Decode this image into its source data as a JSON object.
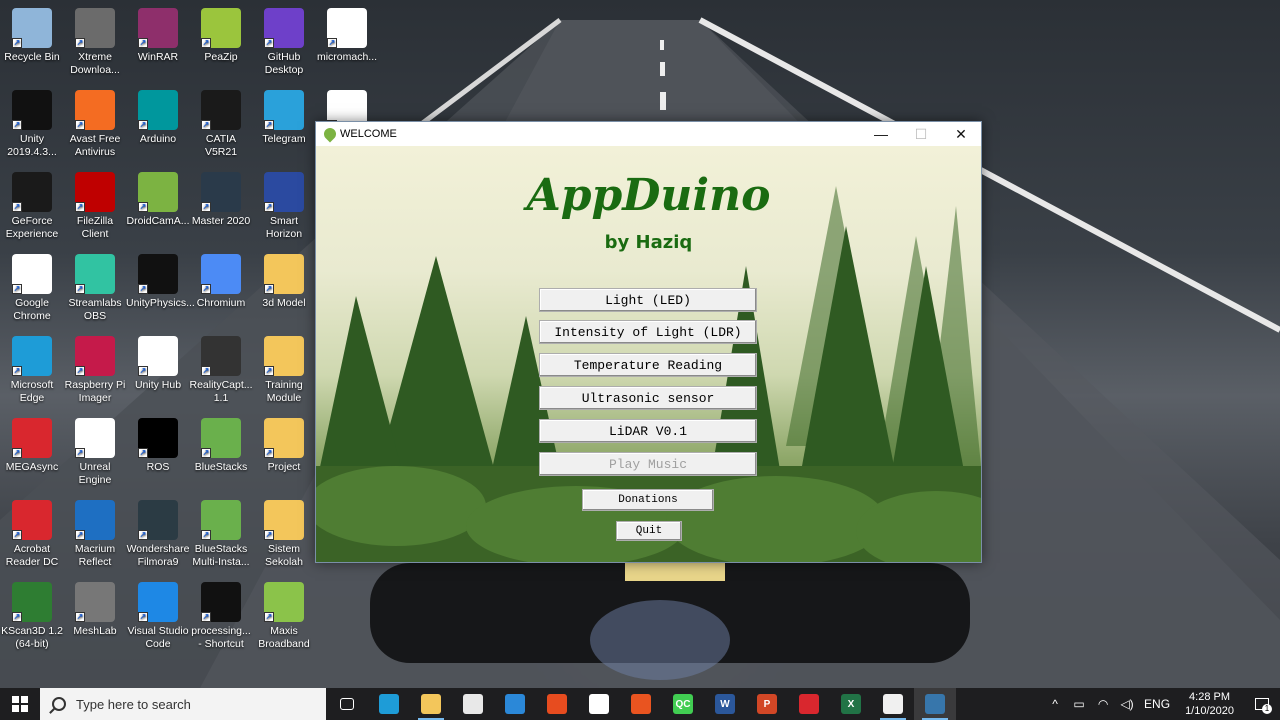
{
  "desktop": {
    "icons": [
      {
        "label": "Recycle Bin",
        "icon": "recycle-bin-icon",
        "color": "#8fb5d9"
      },
      {
        "label": "Xtreme Downloa...",
        "icon": "download-manager-icon",
        "color": "#6b6b6b"
      },
      {
        "label": "WinRAR",
        "icon": "winrar-icon",
        "color": "#8e2f6b"
      },
      {
        "label": "PeaZip",
        "icon": "peazip-icon",
        "color": "#9bc53d"
      },
      {
        "label": "GitHub Desktop",
        "icon": "github-icon",
        "color": "#6e40c9"
      },
      {
        "label": "micromach...",
        "icon": "pdf-icon",
        "color": "#ffffff"
      },
      {
        "label": "Unity 2019.4.3...",
        "icon": "unity-icon",
        "color": "#111111"
      },
      {
        "label": "Avast Free Antivirus",
        "icon": "avast-icon",
        "color": "#f46c22"
      },
      {
        "label": "Arduino",
        "icon": "arduino-icon",
        "color": "#00979d"
      },
      {
        "label": "CATIA V5R21",
        "icon": "catia-icon",
        "color": "#1a1a1a"
      },
      {
        "label": "Telegram",
        "icon": "telegram-icon",
        "color": "#2aa1da"
      },
      {
        "label": "",
        "icon": "word-doc-icon",
        "color": "#ffffff"
      },
      {
        "label": "GeForce Experience",
        "icon": "nvidia-icon",
        "color": "#1a1a1a"
      },
      {
        "label": "FileZilla Client",
        "icon": "filezilla-icon",
        "color": "#bf0000"
      },
      {
        "label": "DroidCamA...",
        "icon": "droidcam-icon",
        "color": "#7cb342"
      },
      {
        "label": "Master 2020",
        "icon": "master-icon",
        "color": "#2a3a4a"
      },
      {
        "label": "Smart Horizon",
        "icon": "smart-horizon-icon",
        "color": "#2b4aa0"
      },
      {
        "label": "Google Chrome",
        "icon": "chrome-icon",
        "color": "#ffffff"
      },
      {
        "label": "Streamlabs OBS",
        "icon": "streamlabs-icon",
        "color": "#31c3a2"
      },
      {
        "label": "UnityPhysics...",
        "icon": "unity-icon",
        "color": "#111111"
      },
      {
        "label": "Chromium",
        "icon": "chromium-icon",
        "color": "#4c8bf5"
      },
      {
        "label": "3d Model",
        "icon": "folder-icon",
        "color": "#f3c65b"
      },
      {
        "label": "Microsoft Edge",
        "icon": "edge-icon",
        "color": "#1e9cd7"
      },
      {
        "label": "Raspberry Pi Imager",
        "icon": "raspberry-icon",
        "color": "#c51a4a"
      },
      {
        "label": "Unity Hub",
        "icon": "unity-hub-icon",
        "color": "#ffffff"
      },
      {
        "label": "RealityCapt... 1.1",
        "icon": "realitycapture-icon",
        "color": "#333333"
      },
      {
        "label": "Training Module",
        "icon": "folder-icon",
        "color": "#f3c65b"
      },
      {
        "label": "MEGAsync",
        "icon": "mega-icon",
        "color": "#d9272e"
      },
      {
        "label": "Unreal Engine",
        "icon": "unreal-icon",
        "color": "#ffffff"
      },
      {
        "label": "ROS",
        "icon": "ros-icon",
        "color": "#000000"
      },
      {
        "label": "BlueStacks",
        "icon": "bluestacks-icon",
        "color": "#6ab04c"
      },
      {
        "label": "Project",
        "icon": "folder-icon",
        "color": "#f3c65b"
      },
      {
        "label": "Acrobat Reader DC",
        "icon": "acrobat-icon",
        "color": "#d9272e"
      },
      {
        "label": "Macrium Reflect",
        "icon": "macrium-icon",
        "color": "#1e6fc2"
      },
      {
        "label": "Wondershare Filmora9",
        "icon": "filmora-icon",
        "color": "#2b3b44"
      },
      {
        "label": "BlueStacks Multi-Insta...",
        "icon": "bluestacks-icon",
        "color": "#6ab04c"
      },
      {
        "label": "Sistem Sekolah",
        "icon": "folder-icon",
        "color": "#f3c65b"
      },
      {
        "label": "KScan3D 1.2 (64-bit)",
        "icon": "kscan-icon",
        "color": "#2e7d32"
      },
      {
        "label": "MeshLab",
        "icon": "meshlab-icon",
        "color": "#777777"
      },
      {
        "label": "Visual Studio Code",
        "icon": "vscode-icon",
        "color": "#1e88e5"
      },
      {
        "label": "processing... - Shortcut",
        "icon": "processing-icon",
        "color": "#111111"
      },
      {
        "label": "Maxis Broadband",
        "icon": "maxis-icon",
        "color": "#8bc34a"
      }
    ]
  },
  "window": {
    "title": "WELCOME",
    "minimize": "—",
    "maximize": "☐",
    "close": "✕",
    "app_title": "AppDuino",
    "app_subtitle": "by Haziq",
    "buttons": [
      {
        "label": "Light (LED)",
        "enabled": true
      },
      {
        "label": "Intensity of Light (LDR)",
        "enabled": true
      },
      {
        "label": "Temperature Reading",
        "enabled": true
      },
      {
        "label": "Ultrasonic sensor",
        "enabled": true
      },
      {
        "label": "LiDAR V0.1",
        "enabled": true
      },
      {
        "label": "Play Music",
        "enabled": false
      }
    ],
    "donations_label": "Donations",
    "quit_label": "Quit"
  },
  "taskbar": {
    "search_placeholder": "Type here to search",
    "apps": [
      {
        "icon": "task-view-icon",
        "label": "",
        "color": "#1e1e20"
      },
      {
        "icon": "edge-icon",
        "label": "",
        "color": "#1e9cd7"
      },
      {
        "icon": "file-explorer-icon",
        "label": "",
        "color": "#f3c65b"
      },
      {
        "icon": "store-icon",
        "label": "",
        "color": "#e8e8e8"
      },
      {
        "icon": "mail-icon",
        "label": "",
        "color": "#2b88d8"
      },
      {
        "icon": "office-icon",
        "label": "",
        "color": "#e74c1f"
      },
      {
        "icon": "chrome-icon",
        "label": "",
        "color": "#ffffff"
      },
      {
        "icon": "ubuntu-icon",
        "label": "",
        "color": "#e95420"
      },
      {
        "icon": "qt-icon",
        "label": "QC",
        "color": "#41cd52"
      },
      {
        "icon": "word-icon",
        "label": "W",
        "color": "#2b579a"
      },
      {
        "icon": "powerpoint-icon",
        "label": "P",
        "color": "#d24726"
      },
      {
        "icon": "acrobat-icon",
        "label": "",
        "color": "#d9272e"
      },
      {
        "icon": "excel-icon",
        "label": "X",
        "color": "#217346"
      },
      {
        "icon": "python-idle-icon",
        "label": "",
        "color": "#f0f0f0"
      },
      {
        "icon": "python-icon",
        "label": "",
        "color": "#3776ab"
      }
    ],
    "language": "ENG",
    "time": "4:28 PM",
    "date": "1/10/2020",
    "notification_count": "1"
  }
}
